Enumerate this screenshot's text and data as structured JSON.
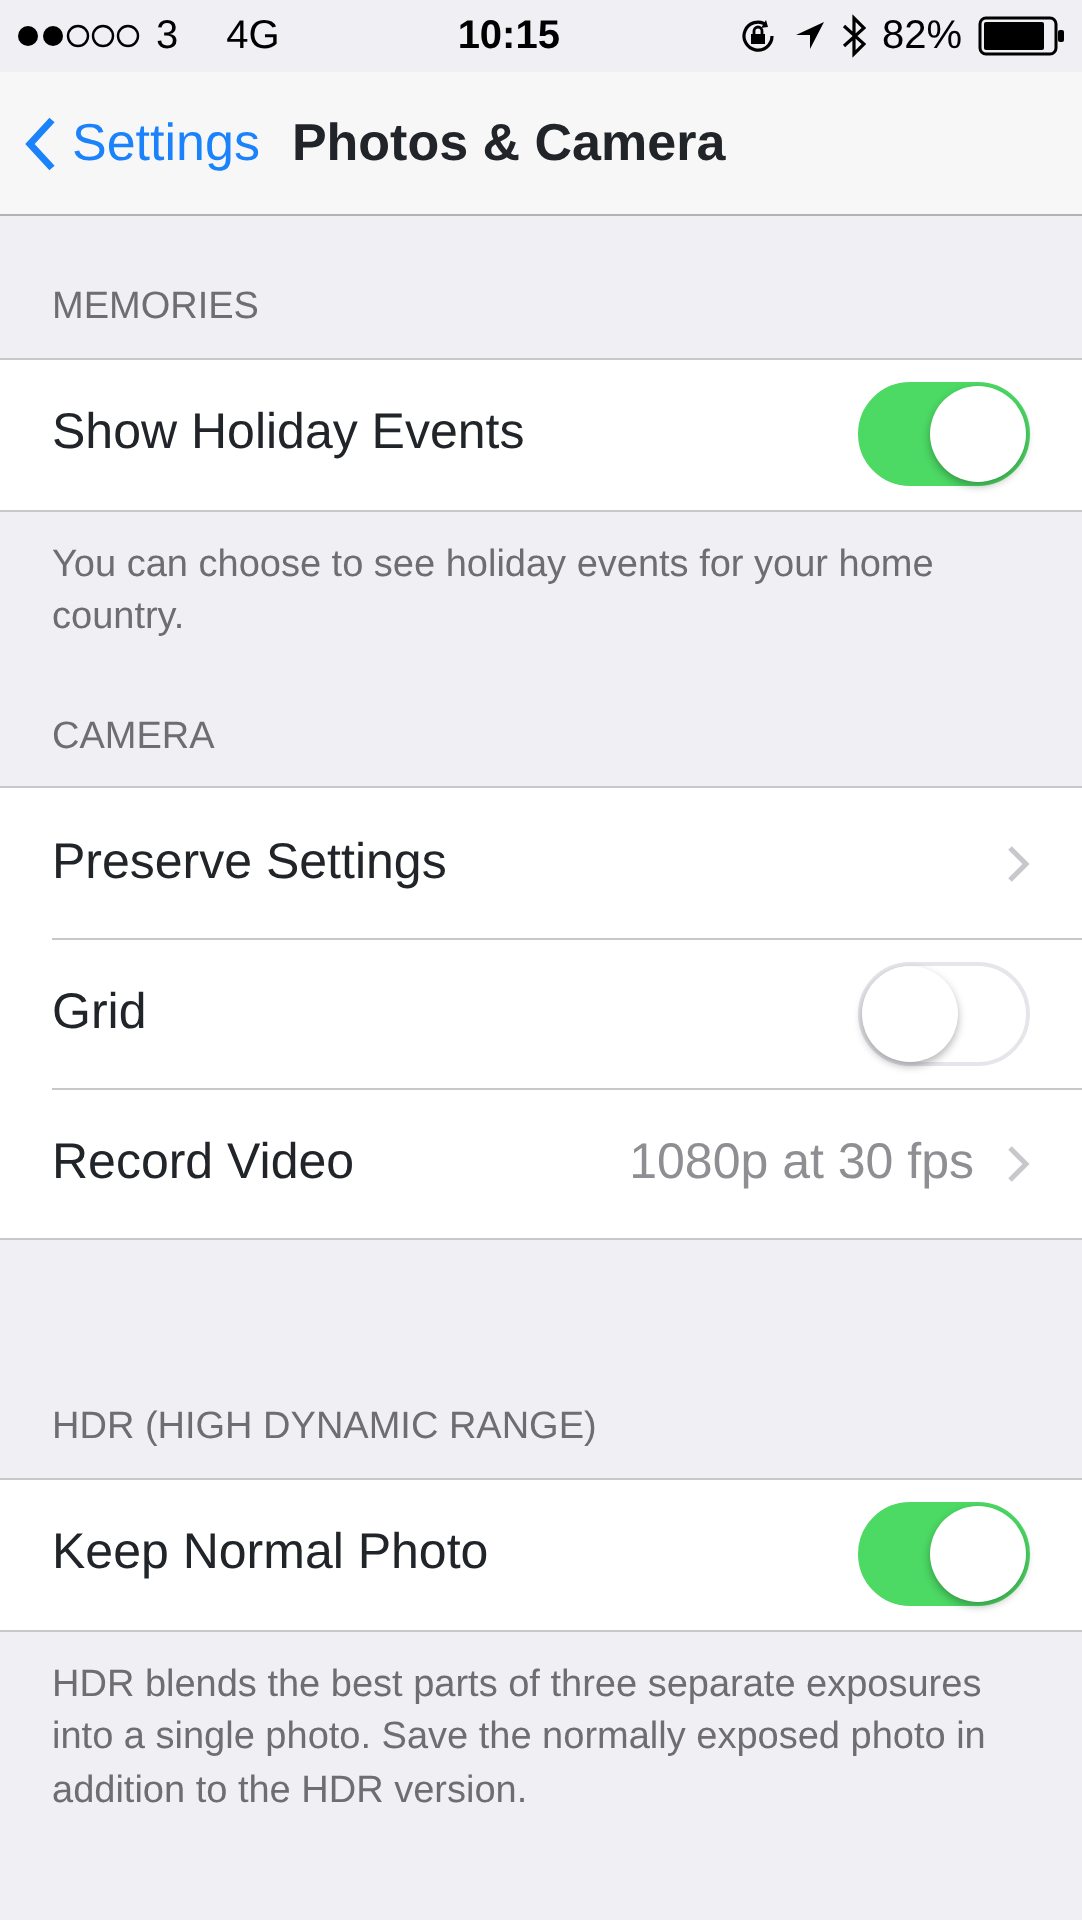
{
  "status_bar": {
    "carrier": "3",
    "network": "4G",
    "time": "10:15",
    "battery": "82%"
  },
  "nav": {
    "back": "Settings",
    "title": "Photos & Camera"
  },
  "sections": [
    {
      "header": "MEMORIES",
      "rows": [
        {
          "kind": "toggle",
          "label": "Show Holiday Events",
          "on": true
        }
      ],
      "footer": "You can choose to see holiday events for your home country."
    },
    {
      "header": "CAMERA",
      "rows": [
        {
          "kind": "link",
          "label": "Preserve Settings"
        },
        {
          "kind": "toggle",
          "label": "Grid",
          "on": false
        },
        {
          "kind": "link",
          "label": "Record Video",
          "value": "1080p at 30 fps"
        }
      ]
    },
    {
      "header": "HDR (HIGH DYNAMIC RANGE)",
      "rows": [
        {
          "kind": "toggle",
          "label": "Keep Normal Photo",
          "on": true
        }
      ],
      "footer": "HDR blends the best parts of three separate exposures into a single photo. Save the normally exposed photo in addition to the HDR version."
    }
  ]
}
